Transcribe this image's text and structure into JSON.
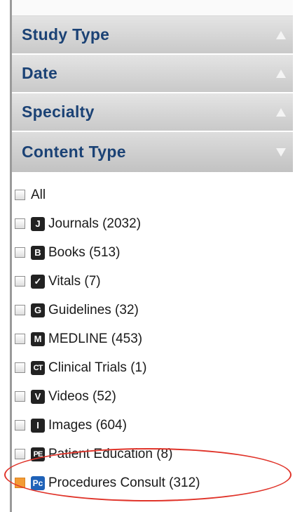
{
  "sections": [
    {
      "label": "Study Type",
      "expanded": false
    },
    {
      "label": "Date",
      "expanded": false
    },
    {
      "label": "Specialty",
      "expanded": false
    },
    {
      "label": "Content Type",
      "expanded": true
    }
  ],
  "content_type_items": [
    {
      "label": "All",
      "badge": "",
      "checked": false
    },
    {
      "label": "Journals (2032)",
      "badge": "J",
      "checked": false
    },
    {
      "label": "Books (513)",
      "badge": "B",
      "checked": false
    },
    {
      "label": "Vitals (7)",
      "badge": "✓",
      "checked": false
    },
    {
      "label": "Guidelines (32)",
      "badge": "G",
      "checked": false
    },
    {
      "label": "MEDLINE (453)",
      "badge": "M",
      "checked": false
    },
    {
      "label": "Clinical Trials (1)",
      "badge": "CT",
      "checked": false
    },
    {
      "label": "Videos (52)",
      "badge": "V",
      "checked": false
    },
    {
      "label": "Images (604)",
      "badge": "I",
      "checked": false
    },
    {
      "label": "Patient Education (8)",
      "badge": "PE",
      "checked": false
    },
    {
      "label": "Procedures Consult (312)",
      "badge": "Pc",
      "checked": true
    }
  ],
  "colors": {
    "header_text": "#1b4275",
    "checked": "#f39b34",
    "highlight_ellipse": "#e0342a"
  }
}
